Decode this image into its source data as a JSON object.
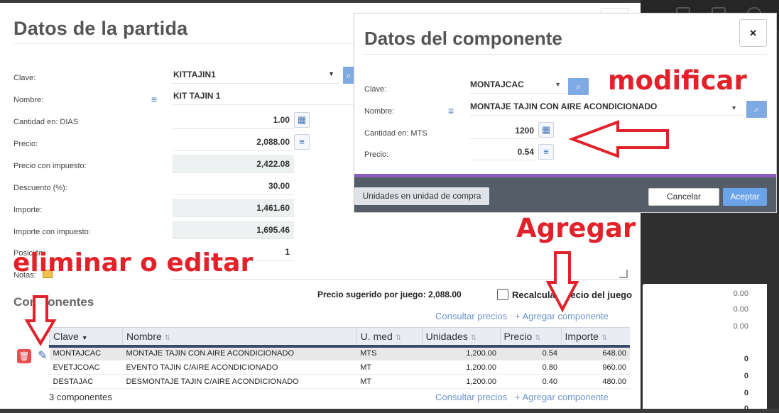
{
  "main_modal": {
    "title": "Datos de la partida",
    "fields": {
      "clave_label": "Clave:",
      "clave_value": "KITTAJIN1",
      "nombre_label": "Nombre:",
      "nombre_value": "KIT TAJIN 1",
      "cantidad_label": "Cantidad en: DIAS",
      "cantidad_value": "1.00",
      "precio_label": "Precio:",
      "precio_value": "2,088.00",
      "precio_imp_label": "Precio con impuesto:",
      "precio_imp_value": "2,422.08",
      "descuento_label": "Descuento (%):",
      "descuento_value": "30.00",
      "importe_label": "Importe:",
      "importe_value": "1,461.60",
      "importe_imp_label": "Importe con impuesto:",
      "importe_imp_value": "1,695.46",
      "posicion_label": "Posición:",
      "posicion_value": "1",
      "notas_label": "Notas:"
    },
    "components_title": "Componentes",
    "suggested_price": "Precio sugerido por juego: 2,088.00",
    "recalc_label": "Recalcular precio del juego",
    "consult_link": "Consultar precios",
    "add_link": "+ Agregar componente",
    "table": {
      "headers": [
        "Clave",
        "Nombre",
        "U. med",
        "Unidades",
        "Precio",
        "Importe"
      ],
      "rows": [
        [
          "MONTAJCAC",
          "MONTAJE TAJIN CON AIRE ACONDICIONADO",
          "MTS",
          "1,200.00",
          "0.54",
          "648.00"
        ],
        [
          "EVETJCOAC",
          "EVENTO TAJIN C/AIRE ACONDICIONADO",
          "MT",
          "1,200.00",
          "0.80",
          "960.00"
        ],
        [
          "DESTAJAC",
          "DESMONTAJE TAJIN C/AIRE ACONDICIONADO",
          "MT",
          "1,200.00",
          "0.40",
          "480.00"
        ]
      ]
    },
    "count_label": "3 componentes"
  },
  "component_modal": {
    "title": "Datos del componente",
    "close_label": "×",
    "clave_label": "Clave:",
    "clave_value": "MONTAJCAC",
    "nombre_label": "Nombre:",
    "nombre_value": "MONTAJE TAJIN CON AIRE ACONDICIONADO",
    "cantidad_label": "Cantidad en: MTS",
    "cantidad_value": "1200",
    "precio_label": "Precio:",
    "precio_value": "0.54",
    "units_button": "Unidades en unidad de compra",
    "cancel_button": "Cancelar",
    "accept_button": "Aceptar"
  },
  "annotations": {
    "modificar": "modificar",
    "agregar": "Agregar",
    "eliminar": "eliminar o editar"
  },
  "background": {
    "values": [
      "0.00",
      "0.00",
      "0.00",
      "0",
      "0",
      "0",
      "0"
    ]
  },
  "colors": {
    "accent": "#7fa9e2",
    "annotation": "#e2222a",
    "purple_bar": "#8c5cbc",
    "footer": "#555d68"
  }
}
